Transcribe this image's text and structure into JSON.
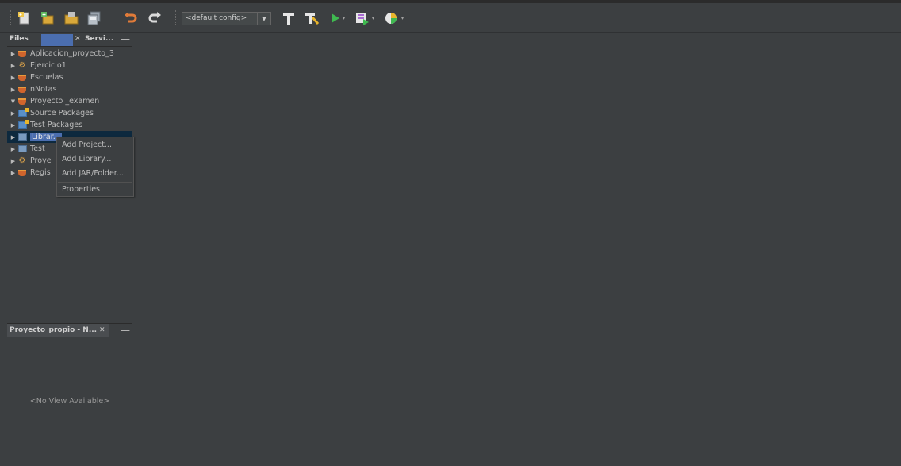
{
  "toolbar": {
    "icons": [
      "new-file-icon",
      "new-project-icon",
      "open-project-icon",
      "save-all-icon",
      "undo-icon",
      "redo-icon",
      "build-icon",
      "clean-build-icon",
      "run-icon",
      "debug-icon",
      "profile-icon"
    ],
    "config_value": "<default config>"
  },
  "left_panel": {
    "tabs": [
      {
        "label": "Files",
        "active": false
      },
      {
        "label": "",
        "active": true
      },
      {
        "label": "Servi...",
        "active": false
      }
    ],
    "tree": [
      {
        "label": "Aplicacion_proyecto_3",
        "expanded": false,
        "icon": "java-project-icon"
      },
      {
        "label": "Ejercicio1",
        "expanded": false,
        "icon": "web-project-icon"
      },
      {
        "label": "Escuelas",
        "expanded": false,
        "icon": "java-project-icon"
      },
      {
        "label": "nNotas",
        "expanded": false,
        "icon": "java-project-icon"
      },
      {
        "label": "Proyecto _examen",
        "expanded": true,
        "icon": "java-project-icon"
      },
      {
        "label": "Source Packages",
        "expanded": false,
        "icon": "source-package-icon"
      },
      {
        "label": "Test Packages",
        "expanded": false,
        "icon": "test-package-icon"
      },
      {
        "label": "Librar...",
        "expanded": false,
        "icon": "library-icon",
        "selected": true
      },
      {
        "label": "Test",
        "expanded": false,
        "icon": "test-library-icon"
      },
      {
        "label": "Proye",
        "expanded": false,
        "icon": "web-project-icon"
      },
      {
        "label": "Regis",
        "expanded": false,
        "icon": "java-project-icon"
      }
    ]
  },
  "context_menu": {
    "items": [
      "Add Project...",
      "Add Library...",
      "Add JAR/Folder...",
      "Properties"
    ]
  },
  "navigator": {
    "title": "Proyecto_propio - N...",
    "empty_text": "<No View Available>"
  },
  "colors": {
    "background": "#3c3f41",
    "selection": "#4b6eaf",
    "text": "#bbbbbb"
  }
}
